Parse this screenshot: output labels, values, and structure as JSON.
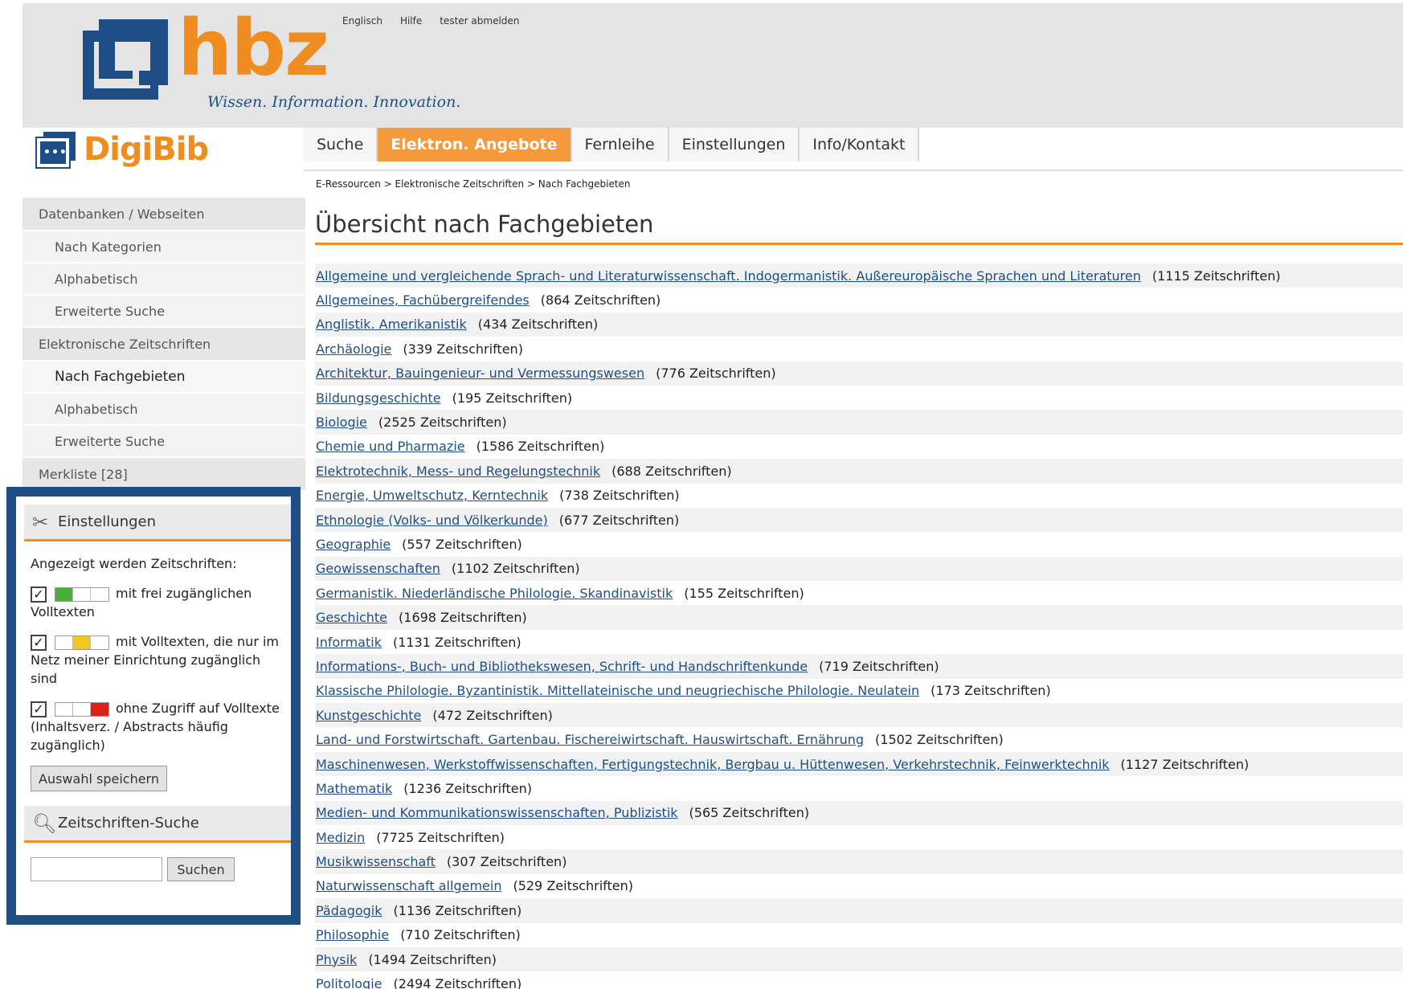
{
  "header": {
    "brand": "hbz",
    "tagline": "Wissen. Information. Innovation.",
    "top_links": [
      "Englisch",
      "Hilfe",
      "tester abmelden"
    ],
    "app_name": "DigiBib"
  },
  "nav": {
    "tabs": [
      {
        "label": "Suche",
        "active": false
      },
      {
        "label": "Elektron. Angebote",
        "active": true
      },
      {
        "label": "Fernleihe",
        "active": false
      },
      {
        "label": "Einstellungen",
        "active": false
      },
      {
        "label": "Info/Kontakt",
        "active": false
      }
    ]
  },
  "breadcrumb": "E-Ressourcen > Elektronische Zeitschriften > Nach Fachgebieten",
  "page_title": "Übersicht nach Fachgebieten",
  "sidebar": {
    "section1": "Datenbanken / Webseiten",
    "section1_items": [
      "Nach Kategorien",
      "Alphabetisch",
      "Erweiterte Suche"
    ],
    "section2": "Elektronische Zeitschriften",
    "section2_items": [
      "Nach Fachgebieten",
      "Alphabetisch",
      "Erweiterte Suche"
    ],
    "merkliste": "Merkliste [28]"
  },
  "settings": {
    "title": "Einstellungen",
    "intro": "Angezeigt werden Zeitschriften:",
    "opt1": "mit frei zugänglichen Volltexten",
    "opt2": "mit Volltexten, die nur im Netz meiner Einrichtung zugänglich sind",
    "opt3": "ohne Zugriff auf Volltexte (Inhaltsverz. / Abstracts häufig zugänglich)",
    "save_label": "Auswahl speichern",
    "search_title": "Zeitschriften-Suche",
    "search_button": "Suchen",
    "colors": {
      "green": "#4caf3c",
      "yellow": "#f2c81e",
      "red": "#d9221c"
    }
  },
  "subjects": [
    {
      "name": "Allgemeine und vergleichende Sprach- und Literaturwissenschaft. Indogermanistik. Außereuropäische Sprachen und Literaturen",
      "count": "(1115 Zeitschriften)"
    },
    {
      "name": "Allgemeines, Fachübergreifendes",
      "count": "(864 Zeitschriften)"
    },
    {
      "name": "Anglistik. Amerikanistik",
      "count": "(434 Zeitschriften)"
    },
    {
      "name": "Archäologie",
      "count": "(339 Zeitschriften)"
    },
    {
      "name": "Architektur, Bauingenieur- und Vermessungswesen",
      "count": "(776 Zeitschriften)"
    },
    {
      "name": "Bildungsgeschichte",
      "count": "(195 Zeitschriften)"
    },
    {
      "name": "Biologie",
      "count": "(2525 Zeitschriften)"
    },
    {
      "name": "Chemie und Pharmazie",
      "count": "(1586 Zeitschriften)"
    },
    {
      "name": "Elektrotechnik, Mess- und Regelungstechnik",
      "count": "(688 Zeitschriften)"
    },
    {
      "name": "Energie, Umweltschutz, Kerntechnik",
      "count": "(738 Zeitschriften)"
    },
    {
      "name": "Ethnologie (Volks- und Völkerkunde)",
      "count": "(677 Zeitschriften)"
    },
    {
      "name": "Geographie",
      "count": "(557 Zeitschriften)"
    },
    {
      "name": "Geowissenschaften",
      "count": "(1102 Zeitschriften)"
    },
    {
      "name": "Germanistik. Niederländische Philologie. Skandinavistik",
      "count": "(155 Zeitschriften)"
    },
    {
      "name": "Geschichte",
      "count": "(1698 Zeitschriften)"
    },
    {
      "name": "Informatik",
      "count": "(1131 Zeitschriften)"
    },
    {
      "name": "Informations-, Buch- und Bibliothekswesen, Schrift- und Handschriftenkunde",
      "count": "(719 Zeitschriften)"
    },
    {
      "name": "Klassische Philologie. Byzantinistik. Mittellateinische und neugriechische Philologie. Neulatein",
      "count": "(173 Zeitschriften)"
    },
    {
      "name": "Kunstgeschichte",
      "count": "(472 Zeitschriften)"
    },
    {
      "name": "Land- und Forstwirtschaft. Gartenbau. Fischereiwirtschaft. Hauswirtschaft. Ernährung",
      "count": "(1502 Zeitschriften)"
    },
    {
      "name": "Maschinenwesen, Werkstoffwissenschaften, Fertigungstechnik, Bergbau u. Hüttenwesen, Verkehrstechnik, Feinwerktechnik",
      "count": "(1127 Zeitschriften)"
    },
    {
      "name": "Mathematik",
      "count": "(1236 Zeitschriften)"
    },
    {
      "name": "Medien- und Kommunikationswissenschaften, Publizistik",
      "count": "(565 Zeitschriften)"
    },
    {
      "name": "Medizin",
      "count": "(7725 Zeitschriften)"
    },
    {
      "name": "Musikwissenschaft",
      "count": "(307 Zeitschriften)"
    },
    {
      "name": "Naturwissenschaft allgemein",
      "count": "(529 Zeitschriften)"
    },
    {
      "name": "Pädagogik",
      "count": "(1136 Zeitschriften)"
    },
    {
      "name": "Philosophie",
      "count": "(710 Zeitschriften)"
    },
    {
      "name": "Physik",
      "count": "(1494 Zeitschriften)"
    },
    {
      "name": "Politologie",
      "count": "(2494 Zeitschriften)"
    }
  ]
}
